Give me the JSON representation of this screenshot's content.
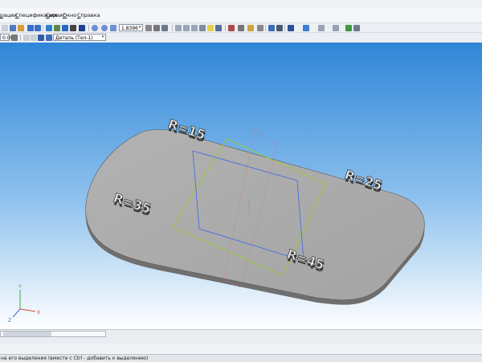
{
  "menu": {
    "items": [
      {
        "id": "operations",
        "label": "рации"
      },
      {
        "id": "spec",
        "label": "Спецификация"
      },
      {
        "id": "service",
        "label": "Сервис"
      },
      {
        "id": "window",
        "label": "Окно"
      },
      {
        "id": "help",
        "label": "Справка"
      }
    ]
  },
  "toolbar": {
    "zoom_value": "1.8396",
    "scale_value": "0.00",
    "detail_select": "Деталь (Тел-1)"
  },
  "model": {
    "labels": [
      "R=15",
      "R=25",
      "R=35",
      "R=45"
    ],
    "triad": {
      "x": "X",
      "y": "Y",
      "z": "Z"
    }
  },
  "status": {
    "text": "на его выделения (вместе с Ctrl - добавить к выделению)"
  },
  "colors": {
    "viewport_top": "#2f86d8",
    "viewport_bottom": "#ffffff",
    "part_top": "#a9a9a9",
    "part_side": "#6e6e6e",
    "plane_blue": "#4a6ee0",
    "plane_green": "#9acd32",
    "plane_red": "#e06a6a"
  }
}
